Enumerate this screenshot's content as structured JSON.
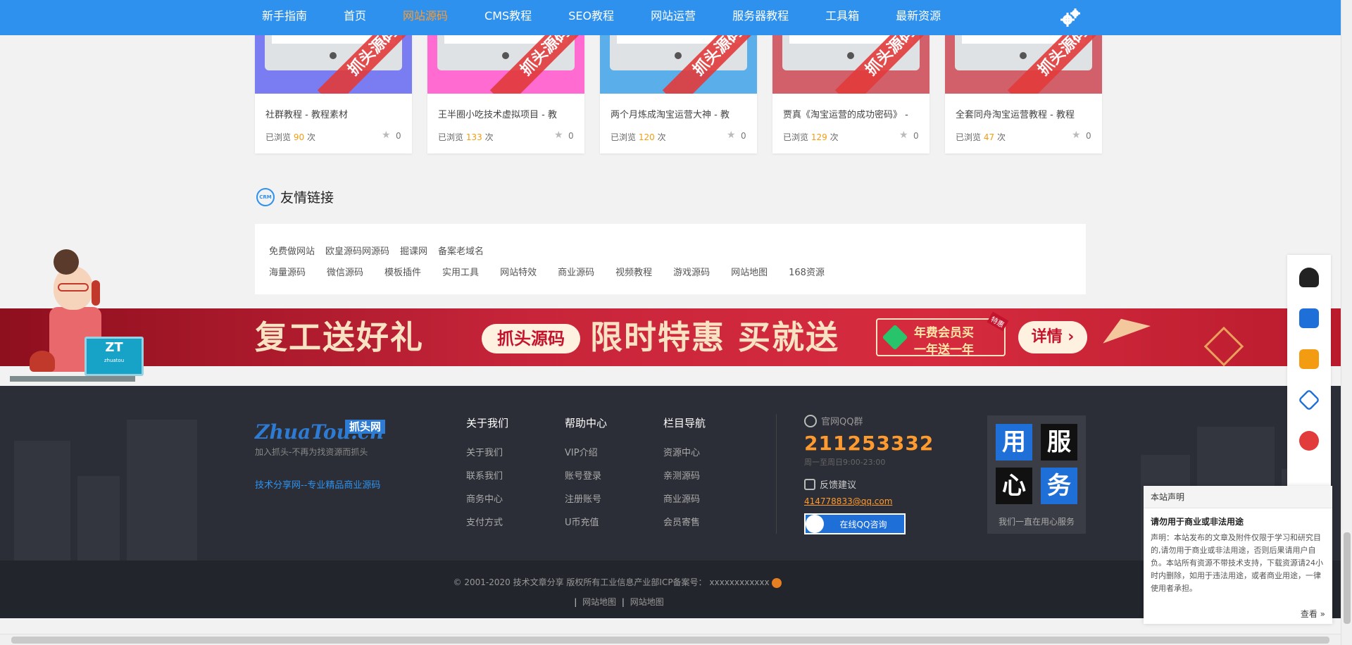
{
  "nav": {
    "items": [
      "新手指南",
      "首页",
      "网站源码",
      "CMS教程",
      "SEO教程",
      "网站运营",
      "服务器教程",
      "工具箱",
      "最新资源"
    ],
    "active": "网站源码",
    "settings_icon": "gear-icon"
  },
  "cards": [
    {
      "title": "社群教程 - 教程素材",
      "views_label": "已浏览",
      "views": "90",
      "unit": "次",
      "likes": "0",
      "ribbon": "抓头源码",
      "thumb_color": "#7a7cf2"
    },
    {
      "title": "王半圈小吃技术虚拟项目 - 教",
      "views_label": "已浏览",
      "views": "133",
      "unit": "次",
      "likes": "0",
      "ribbon": "抓头源码",
      "thumb_color": "#ff6bd0"
    },
    {
      "title": "两个月炼成淘宝运营大神 - 教",
      "views_label": "已浏览",
      "views": "120",
      "unit": "次",
      "likes": "0",
      "ribbon": "抓头源码",
      "thumb_color": "#5aaeea"
    },
    {
      "title": "贾真《淘宝运营的成功密码》 -",
      "views_label": "已浏览",
      "views": "129",
      "unit": "次",
      "likes": "0",
      "ribbon": "抓头源码",
      "thumb_color": "#d1606b"
    },
    {
      "title": "全套同舟淘宝运营教程 - 教程",
      "views_label": "已浏览",
      "views": "47",
      "unit": "次",
      "likes": "0",
      "ribbon": "抓头源码",
      "thumb_color": "#d1606b"
    }
  ],
  "friend_links": {
    "title": "友情链接",
    "icon_text": "CRM",
    "row1": [
      "免费做网站",
      "欧皇源码网源码",
      "掘课网",
      "备案老域名"
    ],
    "row2": [
      "海量源码",
      "微信源码",
      "模板插件",
      "实用工具",
      "网站特效",
      "商业源码",
      "视频教程",
      "游戏源码",
      "网站地图",
      "168资源"
    ]
  },
  "banner": {
    "headline": "复工送好礼",
    "pill": "抓头源码",
    "slogan": "限时特惠 买就送",
    "vip_line1": "年费会员买",
    "vip_line2": "一年送一年",
    "vip_tag": "特惠",
    "detail": "详情 ›"
  },
  "figure": {
    "monitor_big": "ZT",
    "monitor_small": "zhuatou"
  },
  "footer": {
    "logo_main": "ZhuaTou.cn",
    "logo_tag": "抓头网",
    "logo_slogan": "加入抓头-不再为找资源而抓头",
    "tech_line": "技术分享网--专业精品商业源码",
    "columns": [
      {
        "heading": "关于我们",
        "items": [
          "关于我们",
          "联系我们",
          "商务中心",
          "支付方式"
        ]
      },
      {
        "heading": "帮助中心",
        "items": [
          "VIP介绍",
          "账号登录",
          "注册账号",
          "U币充值"
        ]
      },
      {
        "heading": "栏目导航",
        "items": [
          "资源中心",
          "亲测源码",
          "商业源码",
          "会员寄售"
        ]
      }
    ],
    "qq_label": "官网QQ群",
    "qq_number": "211253332",
    "hours": "周一至周日9:00-23:00",
    "feedback_label": "反馈建议",
    "email": "414778833@qq.com",
    "consult_button": "在线QQ咨询",
    "service_glyphs": [
      "用",
      "服",
      "心",
      "务"
    ],
    "service_caption": "我们一直在用心服务"
  },
  "copyright": {
    "line1": "© 2001-2020 技术文章分享 版权所有工业信息产业部ICP备案号：",
    "icp": "xxxxxxxxxxxx",
    "links": [
      "网站地图",
      "网站地图"
    ]
  },
  "sidebar": {
    "icons": [
      "customer-service-icon",
      "home-icon",
      "report-icon",
      "vip-diamond-icon",
      "order-icon"
    ]
  },
  "notice": {
    "header": "本站声明",
    "subtitle": "请勿用于商业或非法用途",
    "body": "声明：本站发布的文章及附件仅限于学习和研究目的,请勿用于商业或非法用途，否则后果请用户自负。本站所有资源不带技术支持，下载资源请24小时内删除，如用于违法用途，或者商业用途，一律使用者承担。",
    "more": "查看 »"
  }
}
